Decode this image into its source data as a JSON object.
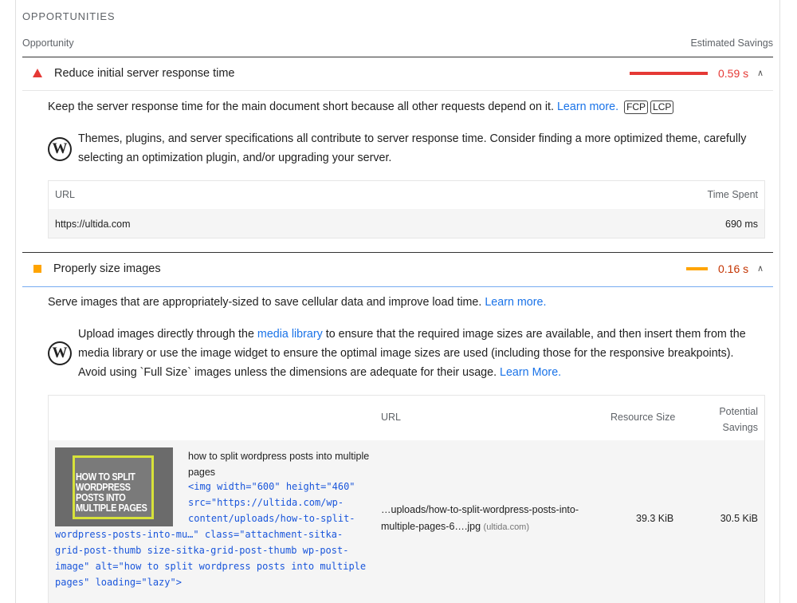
{
  "section": {
    "title": "OPPORTUNITIES"
  },
  "columns": {
    "opportunity": "Opportunity",
    "savings": "Estimated Savings"
  },
  "audits": [
    {
      "title": "Reduce initial server response time",
      "savings": "0.59 s",
      "severity_color": "#e53935",
      "bar_fraction": 1.0,
      "description": "Keep the server response time for the main document short because all other requests depend on it.",
      "learn_more": "Learn more.",
      "chips": [
        "FCP",
        "LCP"
      ],
      "wp_tip": "Themes, plugins, and server specifications all contribute to server response time. Consider finding a more optimized theme, carefully selecting an optimization plugin, and/or upgrading your server.",
      "table": {
        "headers": [
          "URL",
          "Time Spent"
        ],
        "rows": [
          {
            "url": "https://ultida.com",
            "value": "690 ms"
          }
        ]
      }
    },
    {
      "title": "Properly size images",
      "savings": "0.16 s",
      "severity_color": "#ffa400",
      "bar_fraction": 0.27,
      "description": "Serve images that are appropriately-sized to save cellular data and improve load time.",
      "learn_more": "Learn more.",
      "wp_tip_before": "Upload images directly through the",
      "wp_tip_link": "media library",
      "wp_tip_after": "to ensure that the required image sizes are available, and then insert them from the media library or use the image widget to ensure the optimal image sizes are used (including those for the responsive breakpoints). Avoid using `Full Size` images unless the dimensions are adequate for their usage.",
      "wp_tip_learn": "Learn More.",
      "table": {
        "headers": [
          "URL",
          "Resource Size",
          "Potential Savings"
        ],
        "rows": [
          {
            "title": "how to split wordpress posts into multiple pages",
            "code_lines": [
              "<img width=\"600\" height=\"460\"",
              "src=\"https://ultida.com/wp-",
              "content/uploads/how-to-split-",
              "wordpress-posts-into-mu…\" class=\"attachment-sitka-",
              "grid-post-thumb size-sitka-grid-post-thumb wp-post-",
              "image\" alt=\"how to split wordpress posts into multiple",
              "pages\" loading=\"lazy\">"
            ],
            "url_line1": "…uploads/how-to-split-wordpress-posts-into-",
            "url_line2": "multiple-pages-6….jpg",
            "host": "(ultida.com)",
            "size": "39.3 KiB",
            "savings": "30.5 KiB",
            "thumb_text": [
              "HOW TO SPLIT",
              "WORDPRESS",
              "POSTS INTO",
              "MULTIPLE PAGES"
            ]
          }
        ]
      }
    }
  ]
}
